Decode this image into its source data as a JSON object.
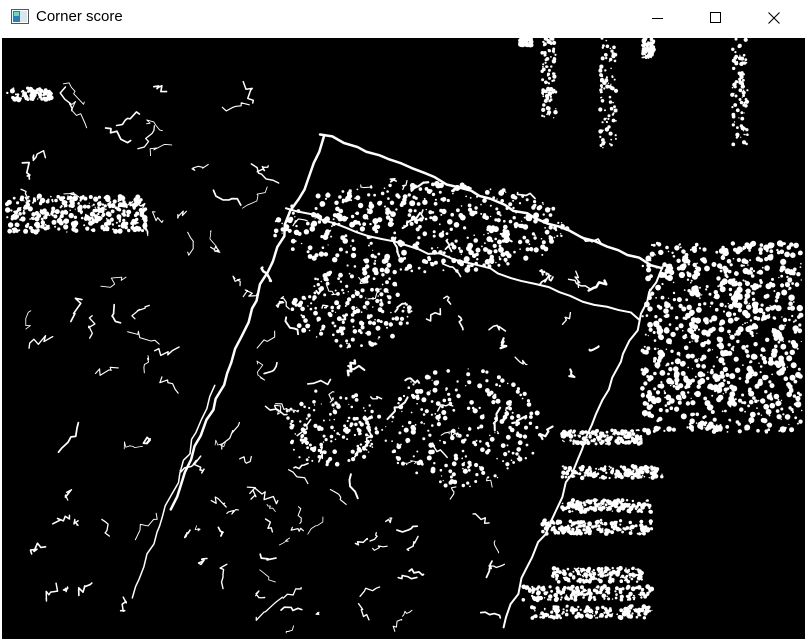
{
  "window": {
    "title": "Corner score",
    "icon": "window-app-icon"
  },
  "controls": {
    "minimize_icon": "minimize-icon",
    "maximize_icon": "maximize-icon",
    "close_icon": "close-icon"
  },
  "image": {
    "description_icon": "corner-score-image"
  },
  "colors": {
    "background": "#000000",
    "foreground": "#ffffff",
    "titlebar": "#ffffff"
  }
}
